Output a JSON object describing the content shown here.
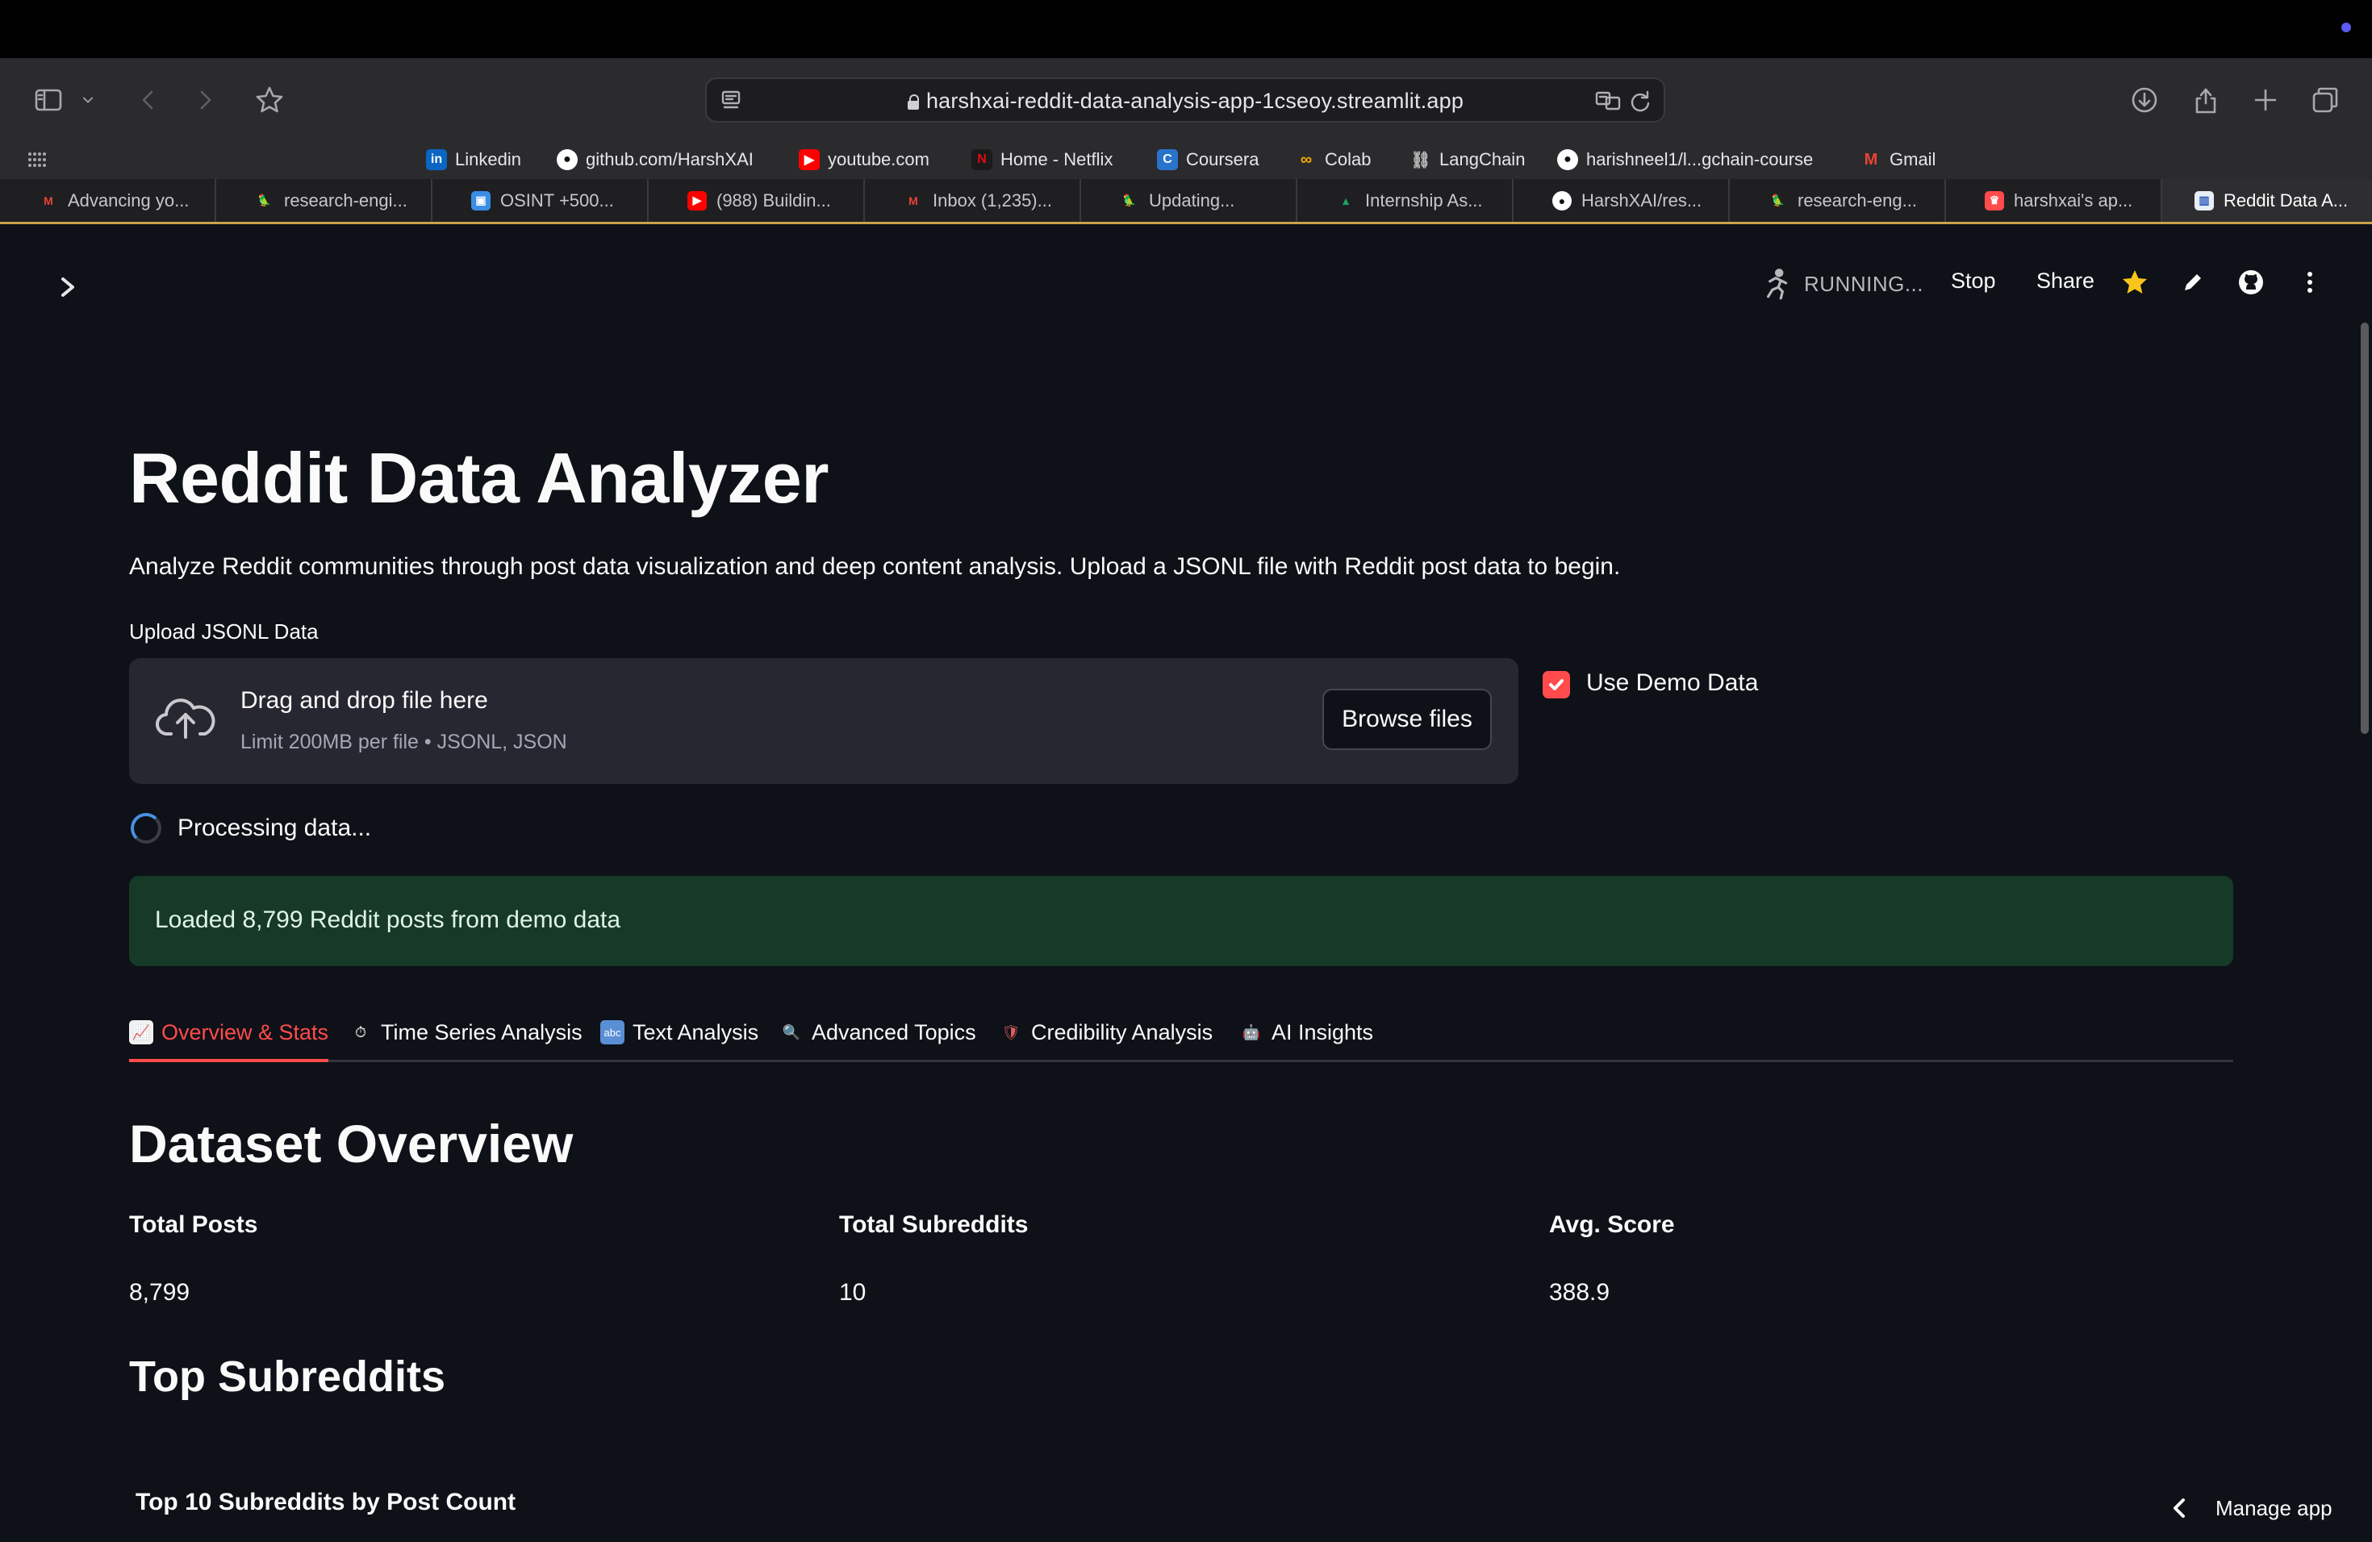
{
  "browser": {
    "url": "harshxai-reddit-data-analysis-app-1cseoy.streamlit.app",
    "bookmarks": [
      {
        "label": "Linkedin",
        "icon": "linkedin-icon",
        "color": "#0a66c2"
      },
      {
        "label": "github.com/HarshXAI",
        "icon": "github-icon",
        "color": "#ffffff"
      },
      {
        "label": "youtube.com",
        "icon": "youtube-icon",
        "color": "#ff0000"
      },
      {
        "label": "Home - Netflix",
        "icon": "netflix-icon",
        "color": "#e50914"
      },
      {
        "label": "Coursera",
        "icon": "coursera-icon",
        "color": "#2a73cc"
      },
      {
        "label": "Colab",
        "icon": "colab-icon",
        "color": "#f9ab00"
      },
      {
        "label": "LangChain",
        "icon": "link-icon",
        "color": "#bdbdbd"
      },
      {
        "label": "harishneel1/l...gchain-course",
        "icon": "github-icon",
        "color": "#ffffff"
      },
      {
        "label": "Gmail",
        "icon": "gmail-icon",
        "color": "#ea4335"
      }
    ],
    "tabs": [
      {
        "label": "Advancing yo...",
        "icon": "gmail-icon",
        "color": "#ea4335"
      },
      {
        "label": "research-engi...",
        "icon": "parrot-icon",
        "color": "#3aa35b"
      },
      {
        "label": "OSINT +500...",
        "icon": "doc-icon",
        "color": "#3a8ee6"
      },
      {
        "label": "(988) Buildin...",
        "icon": "youtube-icon",
        "color": "#ff0000"
      },
      {
        "label": "Inbox (1,235)...",
        "icon": "gmail-icon",
        "color": "#ea4335"
      },
      {
        "label": "Updating...",
        "icon": "parrot-icon",
        "color": "#3aa35b"
      },
      {
        "label": "Internship As...",
        "icon": "drive-icon",
        "color": "#1fa463"
      },
      {
        "label": "HarshXAI/res...",
        "icon": "github-icon",
        "color": "#ffffff"
      },
      {
        "label": "research-eng...",
        "icon": "parrot-icon",
        "color": "#3aa35b"
      },
      {
        "label": "harshxai's ap...",
        "icon": "streamlit-icon",
        "color": "#ff4b4b"
      },
      {
        "label": "Reddit Data A...",
        "icon": "chart-icon",
        "color": "#4a90e2"
      }
    ]
  },
  "app_header": {
    "status": "RUNNING...",
    "stop": "Stop",
    "share": "Share"
  },
  "main": {
    "title": "Reddit Data Analyzer",
    "subtitle": "Analyze Reddit communities through post data visualization and deep content analysis. Upload a JSONL file with Reddit post data to begin.",
    "upload_label": "Upload JSONL Data",
    "drop_title": "Drag and drop file here",
    "drop_limit": "Limit 200MB per file • JSONL, JSON",
    "browse_button": "Browse files",
    "demo_checkbox": "Use Demo Data",
    "demo_checked": true,
    "processing": "Processing data...",
    "success_message": "Loaded 8,799 Reddit posts from demo data",
    "tabs": [
      {
        "emoji": "📈",
        "label": "Overview & Stats",
        "active": true
      },
      {
        "emoji": "⏱",
        "label": "Time Series Analysis",
        "active": false
      },
      {
        "emoji": "🔤",
        "label": "Text Analysis",
        "active": false
      },
      {
        "emoji": "🔍",
        "label": "Advanced Topics",
        "active": false
      },
      {
        "emoji": "🛡",
        "label": "Credibility Analysis",
        "active": false
      },
      {
        "emoji": "🤖",
        "label": "AI Insights",
        "active": false
      }
    ],
    "dataset_overview": "Dataset Overview",
    "metrics": [
      {
        "label": "Total Posts",
        "value": "8,799"
      },
      {
        "label": "Total Subreddits",
        "value": "10"
      },
      {
        "label": "Avg. Score",
        "value": "388.9"
      }
    ],
    "top_subreddits": "Top Subreddits",
    "chart_title": "Top 10 Subreddits by Post Count"
  },
  "footer": {
    "manage_app": "Manage app"
  },
  "colors": {
    "accent": "#ff4b4b",
    "success_bg": "#173928",
    "background": "#0e1117"
  }
}
